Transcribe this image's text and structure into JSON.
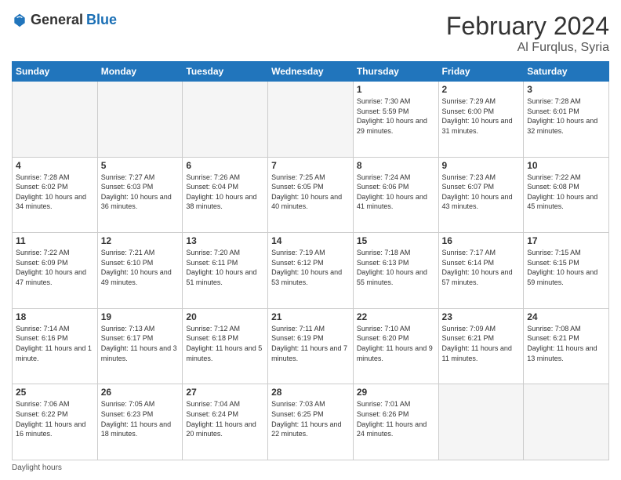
{
  "logo": {
    "general": "General",
    "blue": "Blue"
  },
  "header": {
    "month": "February 2024",
    "location": "Al Furqlus, Syria"
  },
  "weekdays": [
    "Sunday",
    "Monday",
    "Tuesday",
    "Wednesday",
    "Thursday",
    "Friday",
    "Saturday"
  ],
  "weeks": [
    [
      {
        "day": "",
        "sunrise": "",
        "sunset": "",
        "daylight": ""
      },
      {
        "day": "",
        "sunrise": "",
        "sunset": "",
        "daylight": ""
      },
      {
        "day": "",
        "sunrise": "",
        "sunset": "",
        "daylight": ""
      },
      {
        "day": "",
        "sunrise": "",
        "sunset": "",
        "daylight": ""
      },
      {
        "day": "1",
        "sunrise": "Sunrise: 7:30 AM",
        "sunset": "Sunset: 5:59 PM",
        "daylight": "Daylight: 10 hours and 29 minutes."
      },
      {
        "day": "2",
        "sunrise": "Sunrise: 7:29 AM",
        "sunset": "Sunset: 6:00 PM",
        "daylight": "Daylight: 10 hours and 31 minutes."
      },
      {
        "day": "3",
        "sunrise": "Sunrise: 7:28 AM",
        "sunset": "Sunset: 6:01 PM",
        "daylight": "Daylight: 10 hours and 32 minutes."
      }
    ],
    [
      {
        "day": "4",
        "sunrise": "Sunrise: 7:28 AM",
        "sunset": "Sunset: 6:02 PM",
        "daylight": "Daylight: 10 hours and 34 minutes."
      },
      {
        "day": "5",
        "sunrise": "Sunrise: 7:27 AM",
        "sunset": "Sunset: 6:03 PM",
        "daylight": "Daylight: 10 hours and 36 minutes."
      },
      {
        "day": "6",
        "sunrise": "Sunrise: 7:26 AM",
        "sunset": "Sunset: 6:04 PM",
        "daylight": "Daylight: 10 hours and 38 minutes."
      },
      {
        "day": "7",
        "sunrise": "Sunrise: 7:25 AM",
        "sunset": "Sunset: 6:05 PM",
        "daylight": "Daylight: 10 hours and 40 minutes."
      },
      {
        "day": "8",
        "sunrise": "Sunrise: 7:24 AM",
        "sunset": "Sunset: 6:06 PM",
        "daylight": "Daylight: 10 hours and 41 minutes."
      },
      {
        "day": "9",
        "sunrise": "Sunrise: 7:23 AM",
        "sunset": "Sunset: 6:07 PM",
        "daylight": "Daylight: 10 hours and 43 minutes."
      },
      {
        "day": "10",
        "sunrise": "Sunrise: 7:22 AM",
        "sunset": "Sunset: 6:08 PM",
        "daylight": "Daylight: 10 hours and 45 minutes."
      }
    ],
    [
      {
        "day": "11",
        "sunrise": "Sunrise: 7:22 AM",
        "sunset": "Sunset: 6:09 PM",
        "daylight": "Daylight: 10 hours and 47 minutes."
      },
      {
        "day": "12",
        "sunrise": "Sunrise: 7:21 AM",
        "sunset": "Sunset: 6:10 PM",
        "daylight": "Daylight: 10 hours and 49 minutes."
      },
      {
        "day": "13",
        "sunrise": "Sunrise: 7:20 AM",
        "sunset": "Sunset: 6:11 PM",
        "daylight": "Daylight: 10 hours and 51 minutes."
      },
      {
        "day": "14",
        "sunrise": "Sunrise: 7:19 AM",
        "sunset": "Sunset: 6:12 PM",
        "daylight": "Daylight: 10 hours and 53 minutes."
      },
      {
        "day": "15",
        "sunrise": "Sunrise: 7:18 AM",
        "sunset": "Sunset: 6:13 PM",
        "daylight": "Daylight: 10 hours and 55 minutes."
      },
      {
        "day": "16",
        "sunrise": "Sunrise: 7:17 AM",
        "sunset": "Sunset: 6:14 PM",
        "daylight": "Daylight: 10 hours and 57 minutes."
      },
      {
        "day": "17",
        "sunrise": "Sunrise: 7:15 AM",
        "sunset": "Sunset: 6:15 PM",
        "daylight": "Daylight: 10 hours and 59 minutes."
      }
    ],
    [
      {
        "day": "18",
        "sunrise": "Sunrise: 7:14 AM",
        "sunset": "Sunset: 6:16 PM",
        "daylight": "Daylight: 11 hours and 1 minute."
      },
      {
        "day": "19",
        "sunrise": "Sunrise: 7:13 AM",
        "sunset": "Sunset: 6:17 PM",
        "daylight": "Daylight: 11 hours and 3 minutes."
      },
      {
        "day": "20",
        "sunrise": "Sunrise: 7:12 AM",
        "sunset": "Sunset: 6:18 PM",
        "daylight": "Daylight: 11 hours and 5 minutes."
      },
      {
        "day": "21",
        "sunrise": "Sunrise: 7:11 AM",
        "sunset": "Sunset: 6:19 PM",
        "daylight": "Daylight: 11 hours and 7 minutes."
      },
      {
        "day": "22",
        "sunrise": "Sunrise: 7:10 AM",
        "sunset": "Sunset: 6:20 PM",
        "daylight": "Daylight: 11 hours and 9 minutes."
      },
      {
        "day": "23",
        "sunrise": "Sunrise: 7:09 AM",
        "sunset": "Sunset: 6:21 PM",
        "daylight": "Daylight: 11 hours and 11 minutes."
      },
      {
        "day": "24",
        "sunrise": "Sunrise: 7:08 AM",
        "sunset": "Sunset: 6:21 PM",
        "daylight": "Daylight: 11 hours and 13 minutes."
      }
    ],
    [
      {
        "day": "25",
        "sunrise": "Sunrise: 7:06 AM",
        "sunset": "Sunset: 6:22 PM",
        "daylight": "Daylight: 11 hours and 16 minutes."
      },
      {
        "day": "26",
        "sunrise": "Sunrise: 7:05 AM",
        "sunset": "Sunset: 6:23 PM",
        "daylight": "Daylight: 11 hours and 18 minutes."
      },
      {
        "day": "27",
        "sunrise": "Sunrise: 7:04 AM",
        "sunset": "Sunset: 6:24 PM",
        "daylight": "Daylight: 11 hours and 20 minutes."
      },
      {
        "day": "28",
        "sunrise": "Sunrise: 7:03 AM",
        "sunset": "Sunset: 6:25 PM",
        "daylight": "Daylight: 11 hours and 22 minutes."
      },
      {
        "day": "29",
        "sunrise": "Sunrise: 7:01 AM",
        "sunset": "Sunset: 6:26 PM",
        "daylight": "Daylight: 11 hours and 24 minutes."
      },
      {
        "day": "",
        "sunrise": "",
        "sunset": "",
        "daylight": ""
      },
      {
        "day": "",
        "sunrise": "",
        "sunset": "",
        "daylight": ""
      }
    ]
  ],
  "footer": {
    "note": "Daylight hours"
  }
}
